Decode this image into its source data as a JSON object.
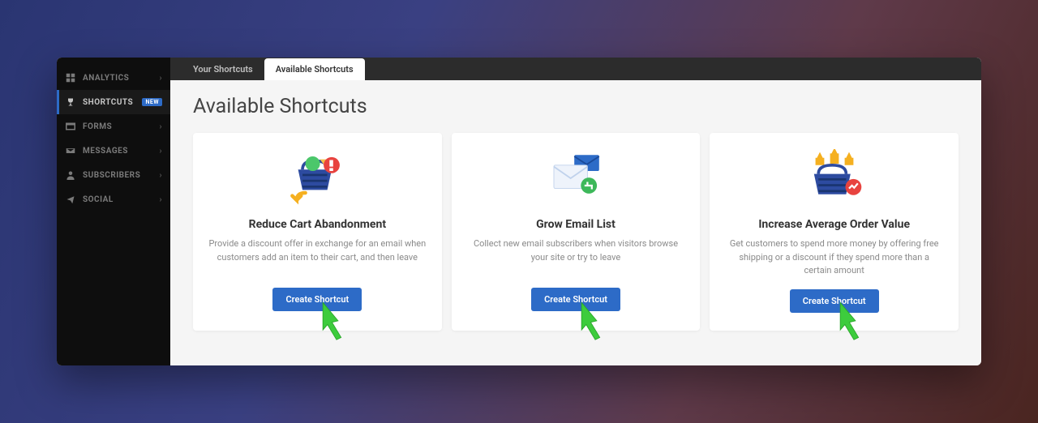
{
  "sidebar": {
    "items": [
      {
        "label": "ANALYTICS"
      },
      {
        "label": "SHORTCUTS",
        "badge": "NEW"
      },
      {
        "label": "FORMS"
      },
      {
        "label": "MESSAGES"
      },
      {
        "label": "SUBSCRIBERS"
      },
      {
        "label": "SOCIAL"
      }
    ]
  },
  "tabs": {
    "items": [
      {
        "label": "Your Shortcuts"
      },
      {
        "label": "Available Shortcuts"
      }
    ]
  },
  "page": {
    "title": "Available Shortcuts"
  },
  "cards": [
    {
      "title": "Reduce Cart Abandonment",
      "description": "Provide a discount offer in exchange for an email when customers add an item to their cart, and then leave",
      "button": "Create Shortcut"
    },
    {
      "title": "Grow Email List",
      "description": "Collect new email subscribers when visitors browse your site or try to leave",
      "button": "Create Shortcut"
    },
    {
      "title": "Increase Average Order Value",
      "description": "Get customers to spend more money by offering free shipping or a discount if they spend more than a certain amount",
      "button": "Create Shortcut"
    }
  ]
}
